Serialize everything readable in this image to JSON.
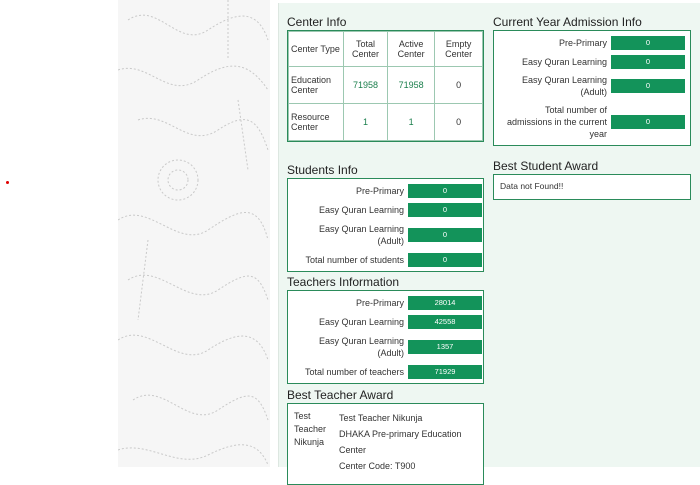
{
  "center_info": {
    "title": "Center Info",
    "headers": [
      "Center Type",
      "Total Center",
      "Active Center",
      "Empty Center"
    ],
    "rows": [
      {
        "type": "Education Center",
        "total": "71958",
        "active": "71958",
        "empty": "0"
      },
      {
        "type": "Resource Center",
        "total": "1",
        "active": "1",
        "empty": "0"
      }
    ]
  },
  "admission_info": {
    "title": "Current Year Admission Info",
    "items": [
      {
        "label": "Pre-Primary",
        "value": "0"
      },
      {
        "label": "Easy Quran Learning",
        "value": "0"
      },
      {
        "label": "Easy Quran Learning (Adult)",
        "value": "0"
      },
      {
        "label": "Total number of admissions in the current year",
        "value": "0"
      }
    ]
  },
  "students_info": {
    "title": "Students Info",
    "items": [
      {
        "label": "Pre-Primary",
        "value": "0"
      },
      {
        "label": "Easy Quran Learning",
        "value": "0"
      },
      {
        "label": "Easy Quran Learning (Adult)",
        "value": "0"
      },
      {
        "label": "Total number of students",
        "value": "0"
      }
    ]
  },
  "best_student_award": {
    "title": "Best Student Award",
    "message": "Data not Found!!"
  },
  "teachers_info": {
    "title": "Teachers Information",
    "items": [
      {
        "label": "Pre-Primary",
        "value": "28014"
      },
      {
        "label": "Easy Quran Learning",
        "value": "42558"
      },
      {
        "label": "Easy Quran Learning (Adult)",
        "value": "1357"
      },
      {
        "label": "Total number of teachers",
        "value": "71929"
      }
    ]
  },
  "best_teacher_award": {
    "title": "Best Teacher Award",
    "image_alt": "Test Teacher Nikunja",
    "name": "Test Teacher Nikunja",
    "center": "DHAKA Pre-primary Education Center",
    "code": "Center Code: T900"
  },
  "colors": {
    "accent": "#13935a",
    "border": "#2a8b5a",
    "panel_bg": "#eef7f2"
  }
}
